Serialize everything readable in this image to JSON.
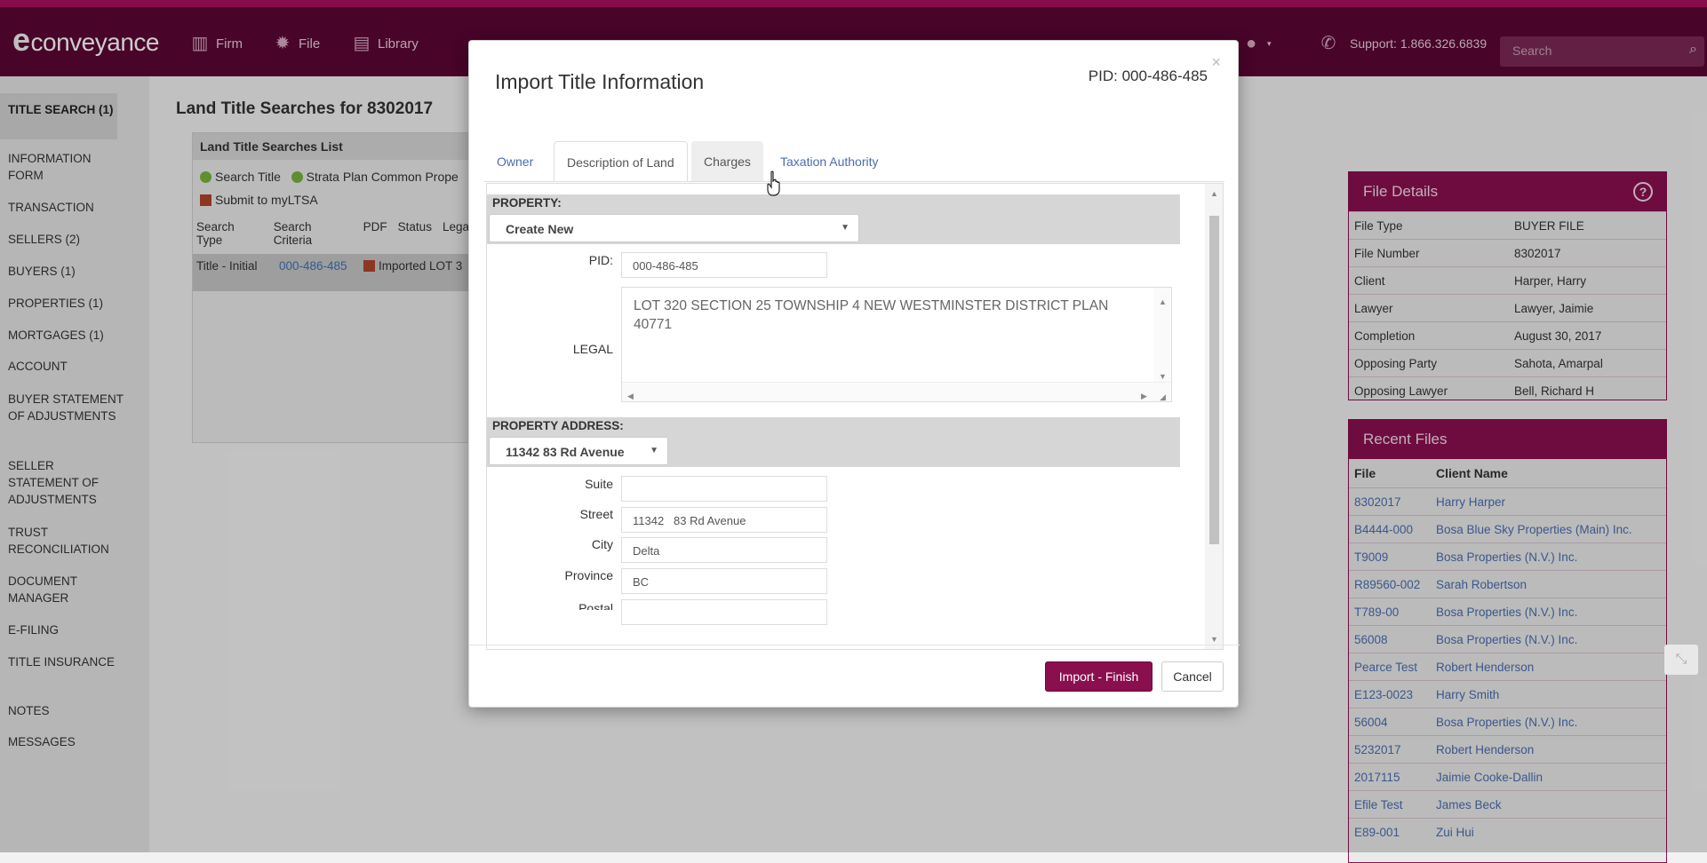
{
  "header": {
    "logo_mark": "e",
    "logo_text": "conveyance",
    "nav": [
      {
        "label": "Firm",
        "icon": "building-icon"
      },
      {
        "label": "File",
        "icon": "gear-icon"
      },
      {
        "label": "Library",
        "icon": "book-icon"
      }
    ],
    "support_text": "Support: 1.866.326.6839",
    "search_placeholder": "Search"
  },
  "sidebar": {
    "items": [
      "TITLE SEARCH (1)",
      "INFORMATION FORM",
      "TRANSACTION",
      "SELLERS (2)",
      "BUYERS (1)",
      "PROPERTIES (1)",
      "MORTGAGES (1)",
      "ACCOUNT",
      "BUYER STATEMENT OF ADJUSTMENTS",
      "SELLER STATEMENT OF ADJUSTMENTS",
      "TRUST RECONCILIATION",
      "DOCUMENT MANAGER",
      "E-FILING",
      "TITLE INSURANCE",
      "NOTES",
      "MESSAGES"
    ]
  },
  "main": {
    "title": "Land Title Searches for 8302017",
    "list_title": "Land Title Searches List",
    "search_title_btn": "Search Title",
    "strata_btn": "Strata Plan Common Prope",
    "submit_btn": "Submit to myLTSA",
    "columns": [
      "Search Type",
      "Search Criteria",
      "PDF",
      "Status",
      "Legal"
    ],
    "row": {
      "type": "Title - Initial",
      "pid": "000-486-485",
      "status": "Imported",
      "legal": "LOT 3"
    }
  },
  "file_details": {
    "title": "File Details",
    "rows": [
      {
        "label": "File Type",
        "value": "BUYER FILE"
      },
      {
        "label": "File Number",
        "value": "8302017"
      },
      {
        "label": "Client",
        "value": "Harper, Harry"
      },
      {
        "label": "Lawyer",
        "value": "Lawyer, Jaimie"
      },
      {
        "label": "Completion",
        "value": "August 30, 2017"
      },
      {
        "label": "Opposing Party",
        "value": "Sahota, Amarpal"
      },
      {
        "label": "Opposing Lawyer",
        "value": "Bell, Richard H"
      }
    ]
  },
  "recent_files": {
    "title": "Recent Files",
    "col_file": "File",
    "col_client": "Client Name",
    "rows": [
      {
        "file": "8302017",
        "client": "Harry Harper"
      },
      {
        "file": "B4444-000",
        "client": "Bosa Blue Sky Properties (Main) Inc."
      },
      {
        "file": "T9009",
        "client": "Bosa Properties (N.V.) Inc."
      },
      {
        "file": "R89560-002",
        "client": "Sarah Robertson"
      },
      {
        "file": "T789-00",
        "client": "Bosa Properties (N.V.) Inc."
      },
      {
        "file": "56008",
        "client": "Bosa Properties (N.V.) Inc."
      },
      {
        "file": "Pearce Test",
        "client": "Robert Henderson"
      },
      {
        "file": "E123-0023",
        "client": "Harry Smith"
      },
      {
        "file": "56004",
        "client": "Bosa Properties (N.V.) Inc."
      },
      {
        "file": "5232017",
        "client": "Robert Henderson"
      },
      {
        "file": "2017115",
        "client": "Jaimie Cooke-Dallin"
      },
      {
        "file": "Efile Test",
        "client": "James Beck"
      },
      {
        "file": "E89-001",
        "client": "Zui Hui"
      }
    ]
  },
  "modal": {
    "title": "Import Title Information",
    "pid_header": "PID: 000-486-485",
    "close": "×",
    "tabs": [
      "Owner",
      "Description of Land",
      "Charges",
      "Taxation Authority"
    ],
    "active_tab": "Description of Land",
    "property_label": "PROPERTY:",
    "property_select": "Create New",
    "pid_label": "PID:",
    "pid_value": "000-486-485",
    "legal_label": "LEGAL",
    "legal_value": "LOT 320 SECTION 25 TOWNSHIP 4 NEW WESTMINSTER DISTRICT PLAN 40771",
    "address_label": "PROPERTY ADDRESS:",
    "address_select": "11342 83 Rd Avenue",
    "suite_label": "Suite",
    "suite_value": "",
    "street_label": "Street",
    "street_value": "11342   83 Rd Avenue",
    "city_label": "City",
    "city_value": "Delta",
    "province_label": "Province",
    "province_value": "BC",
    "postal_label": "Postal",
    "import_button": "Import - Finish",
    "cancel_button": "Cancel"
  },
  "colors": {
    "brand": "#5a0634",
    "accent": "#8a1050",
    "link": "#4a6db0"
  }
}
